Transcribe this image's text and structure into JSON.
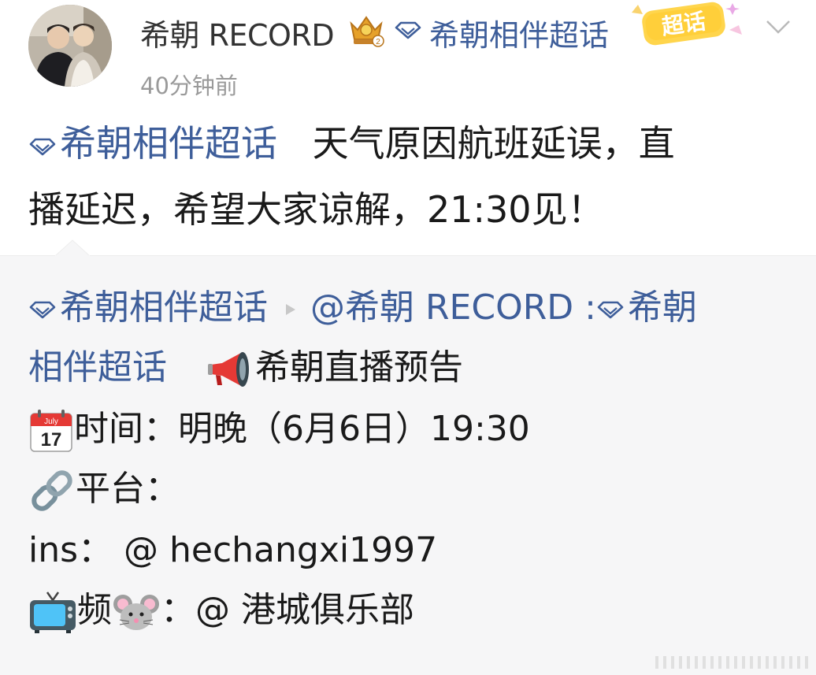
{
  "header": {
    "username": "希朝 RECORD",
    "topic": "希朝相伴超话",
    "badge_text": "超话",
    "timestamp": "40分钟前"
  },
  "post": {
    "topic": "希朝相伴超话",
    "text_line1": "天气原因航班延误，直",
    "text_line2": "播延迟，希望大家谅解，21:30见！"
  },
  "retweet": {
    "topic": "希朝相伴超话",
    "mention": "@希朝 RECORD",
    "colon": " :",
    "topic2_part1": "希朝",
    "topic2_part2": "相伴超话",
    "announce": "希朝直播预告",
    "time_label": "时间：明晚（6月6日）19:30",
    "calendar_month": "July",
    "calendar_day": "17",
    "platform_label": "平台：",
    "ins_line": "ins：  @ hechangxi1997",
    "video_prefix": "频",
    "video_suffix": "：@ 港城俱乐部"
  },
  "colors": {
    "link_blue": "#3e5e9a",
    "timestamp_gray": "#9a9a9a",
    "retweet_bg": "#f6f6f7"
  },
  "icons": [
    "crown-badge-icon",
    "diamond-topic-icon",
    "chaohua-badge-icon",
    "chevron-down-icon",
    "megaphone-icon",
    "calendar-icon",
    "link-icon",
    "tv-icon",
    "mouse-face-icon"
  ]
}
